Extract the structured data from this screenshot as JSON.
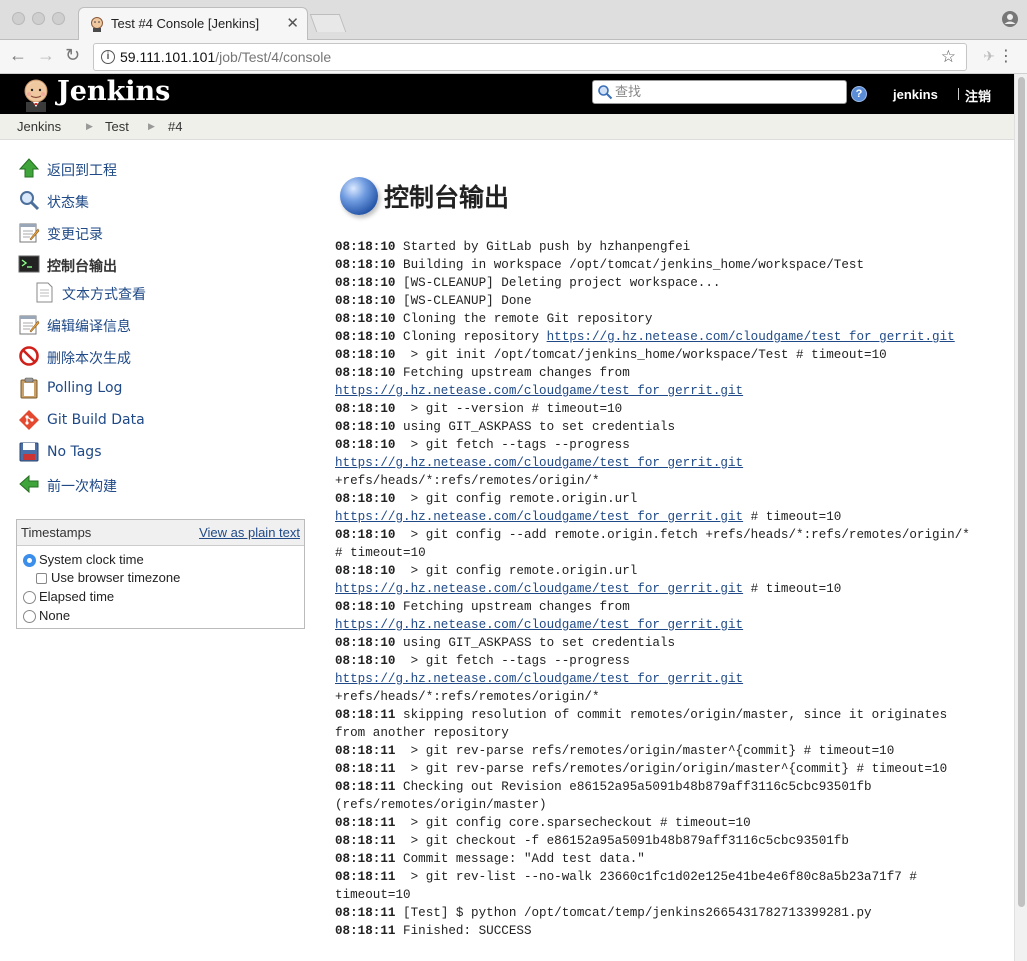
{
  "browser": {
    "tab_title": "Test #4 Console [Jenkins]",
    "url_host": "59.111.101.101",
    "url_path": "/job/Test/4/console"
  },
  "header": {
    "logo_text": "Jenkins",
    "search_placeholder": "查找",
    "help_label": "?",
    "user": "jenkins",
    "logout": "注销"
  },
  "breadcrumb": [
    "Jenkins",
    "Test",
    "#4"
  ],
  "sidebar": {
    "items": [
      {
        "label": "返回到工程",
        "icon": "up-arrow-icon"
      },
      {
        "label": "状态集",
        "icon": "magnifier-icon"
      },
      {
        "label": "变更记录",
        "icon": "notepad-icon"
      },
      {
        "label": "控制台输出",
        "icon": "terminal-icon"
      },
      {
        "label": "文本方式查看",
        "icon": "document-icon"
      },
      {
        "label": "编辑编译信息",
        "icon": "notepad-icon"
      },
      {
        "label": "删除本次生成",
        "icon": "no-entry-icon"
      },
      {
        "label": "Polling Log",
        "icon": "clipboard-icon"
      },
      {
        "label": "Git Build Data",
        "icon": "git-icon"
      },
      {
        "label": "No Tags",
        "icon": "save-icon"
      },
      {
        "label": "前一次构建",
        "icon": "left-arrow-icon"
      }
    ]
  },
  "timestamps": {
    "title": "Timestamps",
    "plain_link": "View as plain text",
    "options": [
      {
        "label": "System clock time",
        "selected": true
      },
      {
        "label": "Use browser timezone",
        "checked": false
      },
      {
        "label": "Elapsed time",
        "selected": false
      },
      {
        "label": "None",
        "selected": false
      }
    ]
  },
  "main": {
    "title": "控制台输出",
    "console": [
      {
        "ts": "08:18:10",
        "text": " Started by GitLab push by hzhanpengfei"
      },
      {
        "ts": "08:18:10",
        "text": " Building in workspace /opt/tomcat/jenkins_home/workspace/Test"
      },
      {
        "ts": "08:18:10",
        "text": " [WS-CLEANUP] Deleting project workspace..."
      },
      {
        "ts": "08:18:10",
        "text": " [WS-CLEANUP] Done"
      },
      {
        "ts": "08:18:10",
        "text": " Cloning the remote Git repository"
      },
      {
        "ts": "08:18:10",
        "text": " Cloning repository ",
        "link": "https://g.hz.netease.com/cloudgame/test_for_gerrit.git"
      },
      {
        "ts": "08:18:10",
        "text": "  > git init /opt/tomcat/jenkins_home/workspace/Test # timeout=10"
      },
      {
        "ts": "08:18:10",
        "text": " Fetching upstream changes from"
      },
      {
        "ts": "",
        "text": "",
        "link": "https://g.hz.netease.com/cloudgame/test_for_gerrit.git"
      },
      {
        "ts": "08:18:10",
        "text": "  > git --version # timeout=10"
      },
      {
        "ts": "08:18:10",
        "text": " using GIT_ASKPASS to set credentials"
      },
      {
        "ts": "08:18:10",
        "text": "  > git fetch --tags --progress"
      },
      {
        "ts": "",
        "text": "",
        "link": "https://g.hz.netease.com/cloudgame/test_for_gerrit.git"
      },
      {
        "ts": "",
        "text": "+refs/heads/*:refs/remotes/origin/*"
      },
      {
        "ts": "08:18:10",
        "text": "  > git config remote.origin.url"
      },
      {
        "ts": "",
        "text": "",
        "link": "https://g.hz.netease.com/cloudgame/test_for_gerrit.git",
        "after": " # timeout=10"
      },
      {
        "ts": "08:18:10",
        "text": "  > git config --add remote.origin.fetch +refs/heads/*:refs/remotes/origin/*"
      },
      {
        "ts": "",
        "text": "# timeout=10"
      },
      {
        "ts": "08:18:10",
        "text": "  > git config remote.origin.url"
      },
      {
        "ts": "",
        "text": "",
        "link": "https://g.hz.netease.com/cloudgame/test_for_gerrit.git",
        "after": " # timeout=10"
      },
      {
        "ts": "08:18:10",
        "text": " Fetching upstream changes from"
      },
      {
        "ts": "",
        "text": "",
        "link": "https://g.hz.netease.com/cloudgame/test_for_gerrit.git"
      },
      {
        "ts": "08:18:10",
        "text": " using GIT_ASKPASS to set credentials"
      },
      {
        "ts": "08:18:10",
        "text": "  > git fetch --tags --progress"
      },
      {
        "ts": "",
        "text": "",
        "link": "https://g.hz.netease.com/cloudgame/test_for_gerrit.git"
      },
      {
        "ts": "",
        "text": "+refs/heads/*:refs/remotes/origin/*"
      },
      {
        "ts": "08:18:11",
        "text": " skipping resolution of commit remotes/origin/master, since it originates"
      },
      {
        "ts": "",
        "text": "from another repository"
      },
      {
        "ts": "08:18:11",
        "text": "  > git rev-parse refs/remotes/origin/master^{commit} # timeout=10"
      },
      {
        "ts": "08:18:11",
        "text": "  > git rev-parse refs/remotes/origin/origin/master^{commit} # timeout=10"
      },
      {
        "ts": "08:18:11",
        "text": " Checking out Revision e86152a95a5091b48b879aff3116c5cbc93501fb"
      },
      {
        "ts": "",
        "text": "(refs/remotes/origin/master)"
      },
      {
        "ts": "08:18:11",
        "text": "  > git config core.sparsecheckout # timeout=10"
      },
      {
        "ts": "08:18:11",
        "text": "  > git checkout -f e86152a95a5091b48b879aff3116c5cbc93501fb"
      },
      {
        "ts": "08:18:11",
        "text": " Commit message: \"Add test data.\""
      },
      {
        "ts": "08:18:11",
        "text": "  > git rev-list --no-walk 23660c1fc1d02e125e41be4e6f80c8a5b23a71f7 #"
      },
      {
        "ts": "",
        "text": "timeout=10"
      },
      {
        "ts": "08:18:11",
        "text": " [Test] $ python /opt/tomcat/temp/jenkins2665431782713399281.py"
      },
      {
        "ts": "08:18:11",
        "text": " Finished: SUCCESS"
      }
    ]
  }
}
